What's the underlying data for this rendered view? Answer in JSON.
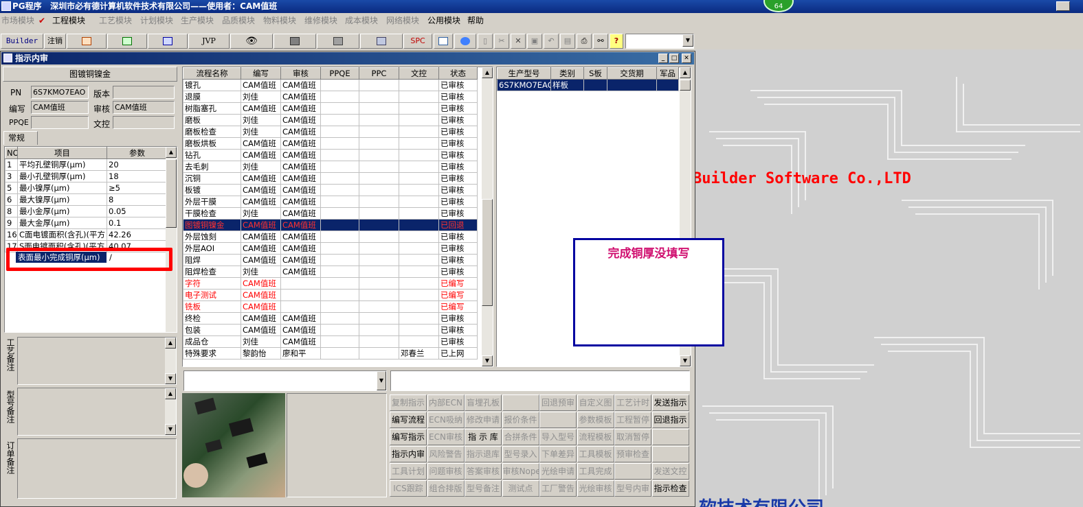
{
  "titlebar": {
    "text": "PG程序   深圳市必有德计算机软件技术有限公司——使用者：CAM值班",
    "badge": "64"
  },
  "menu": [
    "市场模块",
    "工程模块",
    "工艺模块",
    "计划模块",
    "生产模块",
    "品质模块",
    "物料模块",
    "维修模块",
    "成本模块",
    "网络模块",
    "公用模块",
    "帮助"
  ],
  "toolbar": {
    "builder": "Builder",
    "cancel": "注销",
    "jvp": "JVP",
    "spc": "SPC"
  },
  "window": {
    "title": "指示内审"
  },
  "left": {
    "header": "图镀铜镍金",
    "pn_label": "PN",
    "pn_value": "6S7KMO7EAO",
    "version_label": "版本",
    "version_value": "",
    "writer_label": "编写",
    "writer_value": "CAM值班",
    "reviewer_label": "审核",
    "reviewer_value": "CAM值班",
    "ppqe_label": "PPQE",
    "ppqe_value": "",
    "doc_label": "文控",
    "doc_value": "",
    "tab": "常规",
    "cols": [
      "NO",
      "项目",
      "参数"
    ],
    "rows": [
      {
        "no": "1",
        "item": "平均孔壁铜厚(μm)",
        "param": "20"
      },
      {
        "no": "3",
        "item": "最小孔壁铜厚(μm)",
        "param": "18"
      },
      {
        "no": "5",
        "item": "最小镍厚(μm)",
        "param": "≥5"
      },
      {
        "no": "6",
        "item": "最大镍厚(μm)",
        "param": "8"
      },
      {
        "no": "8",
        "item": "最小金厚(μm)",
        "param": "0.05"
      },
      {
        "no": "9",
        "item": "最大金厚(μm)",
        "param": "0.1"
      },
      {
        "no": "16",
        "item": "C面电镀面积(含孔)(平方",
        "param": "42.26"
      },
      {
        "no": "17",
        "item": "S面电镀面积(含孔)(平方",
        "param": "40.07"
      }
    ],
    "edit_value": "表面最小完成铜厚(μm)",
    "edit_suffix": "/",
    "note1": "工艺备注",
    "note2": "型号备注",
    "note3": "订单备注"
  },
  "process": {
    "cols": [
      "流程名称",
      "编写",
      "审核",
      "PPQE",
      "PPC",
      "文控",
      "状态"
    ],
    "rows": [
      {
        "name": "镀孔",
        "writer": "CAM值班",
        "reviewer": "CAM值班",
        "ppqe": "",
        "ppc": "",
        "doc": "",
        "status": "已审核"
      },
      {
        "name": "退膜",
        "writer": "刘佳",
        "reviewer": "CAM值班",
        "ppqe": "",
        "ppc": "",
        "doc": "",
        "status": "已审核"
      },
      {
        "name": "树脂塞孔",
        "writer": "CAM值班",
        "reviewer": "CAM值班",
        "ppqe": "",
        "ppc": "",
        "doc": "",
        "status": "已审核"
      },
      {
        "name": "磨板",
        "writer": "刘佳",
        "reviewer": "CAM值班",
        "ppqe": "",
        "ppc": "",
        "doc": "",
        "status": "已审核"
      },
      {
        "name": "磨板检查",
        "writer": "刘佳",
        "reviewer": "CAM值班",
        "ppqe": "",
        "ppc": "",
        "doc": "",
        "status": "已审核"
      },
      {
        "name": "磨板烘板",
        "writer": "CAM值班",
        "reviewer": "CAM值班",
        "ppqe": "",
        "ppc": "",
        "doc": "",
        "status": "已审核"
      },
      {
        "name": "钻孔",
        "writer": "CAM值班",
        "reviewer": "CAM值班",
        "ppqe": "",
        "ppc": "",
        "doc": "",
        "status": "已审核"
      },
      {
        "name": "去毛刺",
        "writer": "刘佳",
        "reviewer": "CAM值班",
        "ppqe": "",
        "ppc": "",
        "doc": "",
        "status": "已审核"
      },
      {
        "name": "沉铜",
        "writer": "CAM值班",
        "reviewer": "CAM值班",
        "ppqe": "",
        "ppc": "",
        "doc": "",
        "status": "已审核"
      },
      {
        "name": "板镀",
        "writer": "CAM值班",
        "reviewer": "CAM值班",
        "ppqe": "",
        "ppc": "",
        "doc": "",
        "status": "已审核"
      },
      {
        "name": "外层干膜",
        "writer": "CAM值班",
        "reviewer": "CAM值班",
        "ppqe": "",
        "ppc": "",
        "doc": "",
        "status": "已审核"
      },
      {
        "name": "干膜检查",
        "writer": "刘佳",
        "reviewer": "CAM值班",
        "ppqe": "",
        "ppc": "",
        "doc": "",
        "status": "已审核"
      },
      {
        "name": "图镀铜镍金",
        "writer": "CAM值班",
        "reviewer": "CAM值班",
        "ppqe": "",
        "ppc": "",
        "doc": "",
        "status": "已回退",
        "kind": "selred"
      },
      {
        "name": "外层蚀刻",
        "writer": "CAM值班",
        "reviewer": "CAM值班",
        "ppqe": "",
        "ppc": "",
        "doc": "",
        "status": "已审核"
      },
      {
        "name": "外层AOI",
        "writer": "CAM值班",
        "reviewer": "CAM值班",
        "ppqe": "",
        "ppc": "",
        "doc": "",
        "status": "已审核"
      },
      {
        "name": "阻焊",
        "writer": "CAM值班",
        "reviewer": "CAM值班",
        "ppqe": "",
        "ppc": "",
        "doc": "",
        "status": "已审核"
      },
      {
        "name": "阻焊检查",
        "writer": "刘佳",
        "reviewer": "CAM值班",
        "ppqe": "",
        "ppc": "",
        "doc": "",
        "status": "已审核"
      },
      {
        "name": "字符",
        "writer": "CAM值班",
        "reviewer": "",
        "ppqe": "",
        "ppc": "",
        "doc": "",
        "status": "已编写",
        "kind": "red"
      },
      {
        "name": "电子测试",
        "writer": "CAM值班",
        "reviewer": "",
        "ppqe": "",
        "ppc": "",
        "doc": "",
        "status": "已编写",
        "kind": "red"
      },
      {
        "name": "铣板",
        "writer": "CAM值班",
        "reviewer": "",
        "ppqe": "",
        "ppc": "",
        "doc": "",
        "status": "已编写",
        "kind": "red"
      },
      {
        "name": "终检",
        "writer": "CAM值班",
        "reviewer": "CAM值班",
        "ppqe": "",
        "ppc": "",
        "doc": "",
        "status": "已审核"
      },
      {
        "name": "包装",
        "writer": "CAM值班",
        "reviewer": "CAM值班",
        "ppqe": "",
        "ppc": "",
        "doc": "",
        "status": "已审核"
      },
      {
        "name": "成品仓",
        "writer": "刘佳",
        "reviewer": "CAM值班",
        "ppqe": "",
        "ppc": "",
        "doc": "",
        "status": "已审核"
      },
      {
        "name": "特殊要求",
        "writer": "黎韵怡",
        "reviewer": "廖和平",
        "ppqe": "",
        "ppc": "",
        "doc": "邓春兰",
        "status": "已上网"
      }
    ]
  },
  "models": {
    "cols": [
      "生产型号",
      "类别",
      "S板",
      "交货期",
      "军品"
    ],
    "rows": [
      {
        "model": "6S7KMO7EAO",
        "type": "样板",
        "s": "",
        "due": "",
        "mil": ""
      }
    ]
  },
  "buttons": [
    {
      "label": "复制指示",
      "on": false
    },
    {
      "label": "内部ECN",
      "on": false
    },
    {
      "label": "盲埋孔板",
      "on": false
    },
    {
      "label": "",
      "on": false
    },
    {
      "label": "回退预审",
      "on": false
    },
    {
      "label": "自定义图",
      "on": false
    },
    {
      "label": "工艺计时",
      "on": false
    },
    {
      "label": "发送指示",
      "on": true
    },
    {
      "label": "编写流程",
      "on": true
    },
    {
      "label": "ECN吸纳",
      "on": false
    },
    {
      "label": "修改申请",
      "on": false
    },
    {
      "label": "报价条件",
      "on": false
    },
    {
      "label": "",
      "on": false
    },
    {
      "label": "参数模板",
      "on": false
    },
    {
      "label": "工程暂停",
      "on": false
    },
    {
      "label": "回退指示",
      "on": true
    },
    {
      "label": "编写指示",
      "on": true
    },
    {
      "label": "ECN审核",
      "on": false
    },
    {
      "label": "指 示 库",
      "on": true
    },
    {
      "label": "合拼条件",
      "on": false
    },
    {
      "label": "导入型号",
      "on": false
    },
    {
      "label": "流程模板",
      "on": false
    },
    {
      "label": "取消暂停",
      "on": false
    },
    {
      "label": "",
      "on": false
    },
    {
      "label": "指示内审",
      "on": true
    },
    {
      "label": "风险警告",
      "on": false
    },
    {
      "label": "指示退库",
      "on": false
    },
    {
      "label": "型号录入",
      "on": false
    },
    {
      "label": "下单差异",
      "on": false
    },
    {
      "label": "工具模板",
      "on": false
    },
    {
      "label": "预审检查",
      "on": false
    },
    {
      "label": "",
      "on": false
    },
    {
      "label": "工具计划",
      "on": false
    },
    {
      "label": "问题审核",
      "on": false
    },
    {
      "label": "答案审核",
      "on": false
    },
    {
      "label": "审核Nope",
      "on": false
    },
    {
      "label": "光绘申请",
      "on": false
    },
    {
      "label": "工具完成",
      "on": false
    },
    {
      "label": "",
      "on": false
    },
    {
      "label": "发送文控",
      "on": false
    },
    {
      "label": "ICS跟踪",
      "on": false
    },
    {
      "label": "组合排版",
      "on": false
    },
    {
      "label": "型号备注",
      "on": false
    },
    {
      "label": "测试点",
      "on": false
    },
    {
      "label": "工厂警告",
      "on": false
    },
    {
      "label": "光绘审核",
      "on": false
    },
    {
      "label": "型号内审",
      "on": false
    },
    {
      "label": "指示检查",
      "on": true
    }
  ],
  "callout": "完成铜厚没填写",
  "background": {
    "brand": "Builder Software Co.,LTD",
    "bottom_text": "软技术有限公司"
  },
  "colors": {
    "title": "#0a246a",
    "selection": "#0a246a",
    "red": "#ff0000",
    "callout_border": "#0000a0",
    "callout_text": "#d01070",
    "annotation": "#ff0000"
  }
}
